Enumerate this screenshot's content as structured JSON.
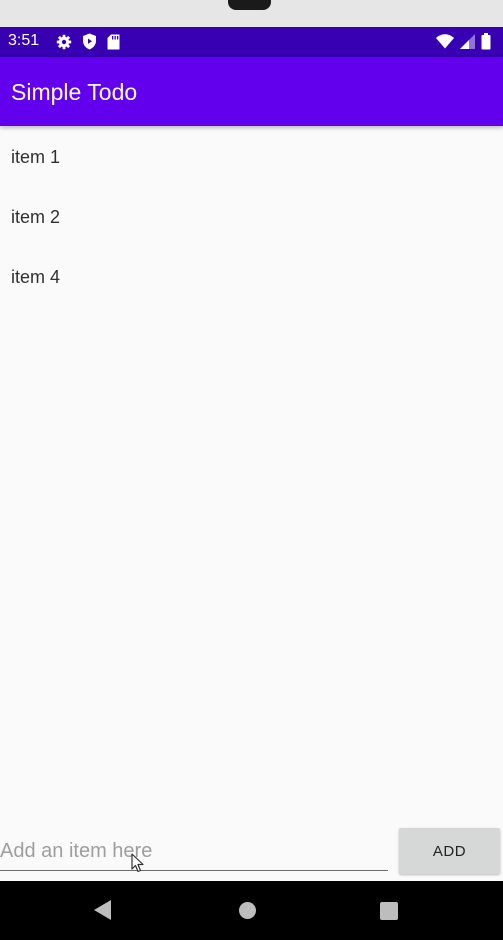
{
  "status_bar": {
    "time": "3:51",
    "left_icons": [
      "gear-icon",
      "shield-icon",
      "sd-card-icon"
    ],
    "right_icons": [
      "wifi-icon",
      "signal-icon",
      "battery-icon"
    ],
    "color": "#3700b3"
  },
  "app_bar": {
    "title": "Simple Todo",
    "color": "#6200ee"
  },
  "todo_list": {
    "items": [
      {
        "label": "item 1"
      },
      {
        "label": "item 2"
      },
      {
        "label": "item 4"
      }
    ]
  },
  "input": {
    "placeholder": "Add an item here",
    "value": ""
  },
  "add_button": {
    "label": "ADD"
  },
  "nav_bar": {
    "buttons": [
      "back-icon",
      "home-icon",
      "recents-icon"
    ]
  }
}
